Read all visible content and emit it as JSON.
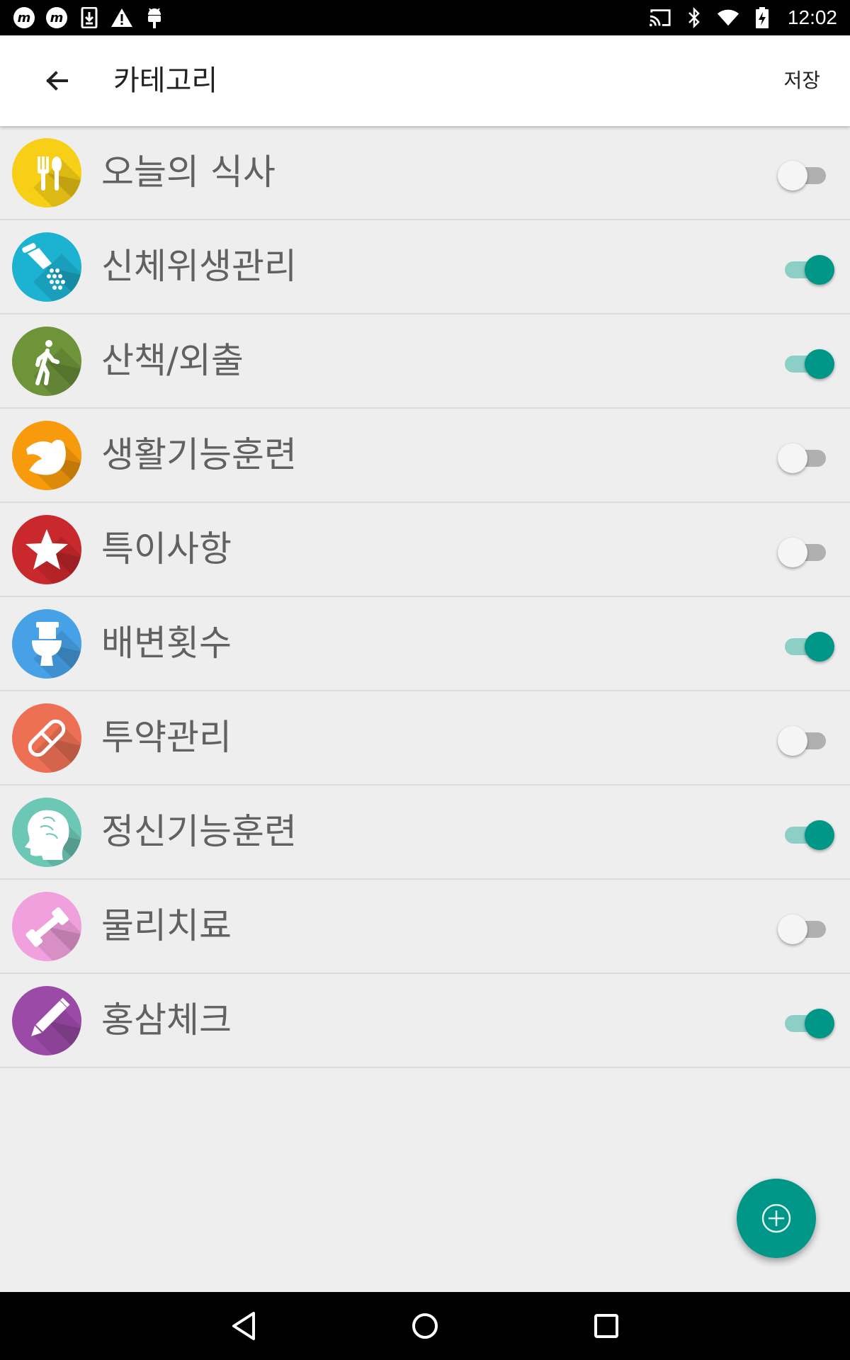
{
  "status_bar": {
    "time": "12:02",
    "left_icons": [
      "m-notification-icon",
      "m-app-icon",
      "download-icon",
      "warning-icon",
      "android-icon"
    ],
    "right_icons": [
      "cast-icon",
      "bluetooth-icon",
      "wifi-icon",
      "battery-charging-icon"
    ]
  },
  "app_bar": {
    "back_icon": "arrow-back-icon",
    "title": "카테고리",
    "save_label": "저장"
  },
  "categories": [
    {
      "label": "오늘의 식사",
      "icon": "utensils-icon",
      "color": "#f6cf16",
      "enabled": false
    },
    {
      "label": "신체위생관리",
      "icon": "shower-icon",
      "color": "#1cb2d1",
      "enabled": true
    },
    {
      "label": "산책/외출",
      "icon": "walking-person-icon",
      "color": "#6e943a",
      "enabled": true
    },
    {
      "label": "생활기능훈련",
      "icon": "muscle-arm-icon",
      "color": "#f79a0c",
      "enabled": false
    },
    {
      "label": "특이사항",
      "icon": "star-icon",
      "color": "#c9282d",
      "enabled": false
    },
    {
      "label": "배변횟수",
      "icon": "toilet-icon",
      "color": "#47a1e6",
      "enabled": true
    },
    {
      "label": "투약관리",
      "icon": "pill-icon",
      "color": "#ed7055",
      "enabled": false
    },
    {
      "label": "정신기능훈련",
      "icon": "brain-head-icon",
      "color": "#6dc7b5",
      "enabled": true
    },
    {
      "label": "물리치료",
      "icon": "dumbbell-icon",
      "color": "#f0a0dc",
      "enabled": false
    },
    {
      "label": "홍삼체크",
      "icon": "pencil-icon",
      "color": "#9c4aa8",
      "enabled": true
    }
  ],
  "fab": {
    "icon": "add-circle-icon",
    "color": "#009688"
  },
  "nav_bar": {
    "back_icon": "nav-back-icon",
    "home_icon": "nav-home-icon",
    "recents_icon": "nav-recents-icon"
  },
  "colors": {
    "accent": "#009688",
    "switch_track_on": "#8ccfc7",
    "switch_track_off": "#b0b0b0",
    "background": "#eeeeee"
  }
}
